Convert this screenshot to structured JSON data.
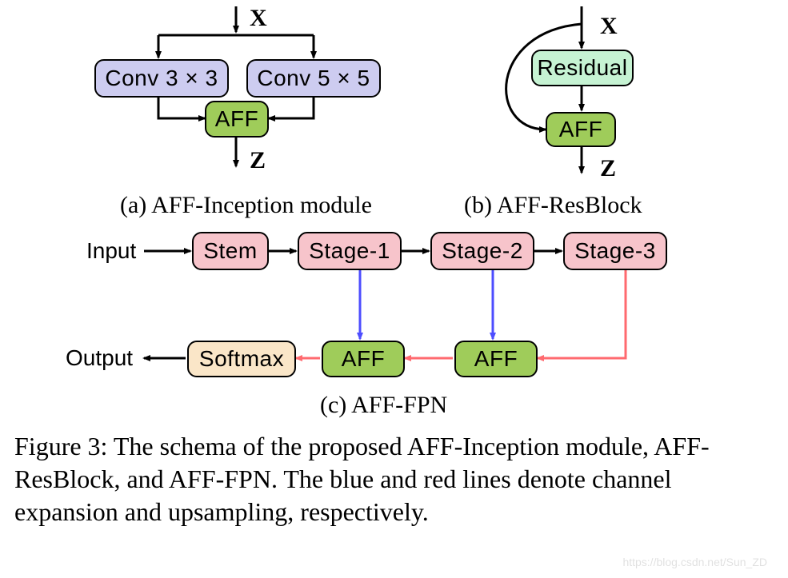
{
  "panelA": {
    "input_label": "X",
    "conv3": "Conv 3 × 3",
    "conv5": "Conv 5 × 5",
    "aff": "AFF",
    "output_label": "Z",
    "caption": "(a) AFF-Inception module"
  },
  "panelB": {
    "input_label": "X",
    "residual": "Residual",
    "aff": "AFF",
    "output_label": "Z",
    "caption": "(b) AFF-ResBlock"
  },
  "panelC": {
    "input": "Input",
    "stem": "Stem",
    "stage1": "Stage-1",
    "stage2": "Stage-2",
    "stage3": "Stage-3",
    "aff1": "AFF",
    "aff2": "AFF",
    "softmax": "Softmax",
    "output": "Output",
    "caption": "(c) AFF-FPN"
  },
  "figure_caption": "Figure 3: The schema of the proposed AFF-Inception module, AFF-ResBlock, and AFF-FPN. The blue and red lines denote channel expansion and upsampling, respectively.",
  "watermark": "https://blog.csdn.net/Sun_ZD"
}
